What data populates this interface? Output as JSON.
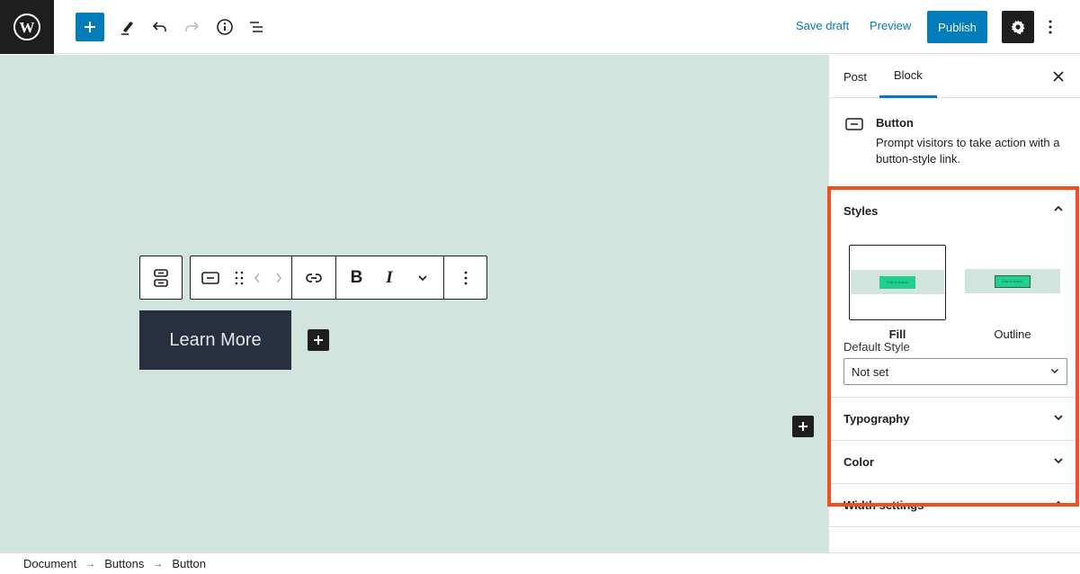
{
  "topbar": {
    "logo": "wordpress-logo",
    "tools": [
      {
        "name": "add-block-toggle",
        "icon": "plus-icon"
      },
      {
        "name": "tools-toggle",
        "icon": "pencil-icon"
      },
      {
        "name": "undo",
        "icon": "undo-icon"
      },
      {
        "name": "redo",
        "icon": "redo-icon",
        "disabled": true
      },
      {
        "name": "details",
        "icon": "info-icon"
      },
      {
        "name": "list-view",
        "icon": "list-view-icon"
      }
    ],
    "save_draft": "Save draft",
    "preview": "Preview",
    "publish": "Publish",
    "settings_icon": "gear-icon",
    "more_icon": "more-vertical-icon"
  },
  "canvas": {
    "background": "#d2e4de",
    "block_toolbar": {
      "groups": [
        [
          "parent-buttons-block-icon"
        ],
        [
          "button-block-icon",
          "drag-handle-icon",
          "move-left-icon",
          "move-right-icon"
        ],
        [
          "link-icon"
        ],
        [
          "bold-icon",
          "italic-icon",
          "more-rich-text-chevron-icon"
        ],
        [
          "options-more-icon"
        ]
      ]
    },
    "button_text": "Learn More",
    "button_color": "#282f3e"
  },
  "sidebar": {
    "tabs": [
      {
        "label": "Post",
        "active": false
      },
      {
        "label": "Block",
        "active": true
      }
    ],
    "close_icon": "close-icon",
    "block": {
      "icon": "button-block-icon",
      "title": "Button",
      "description": "Prompt visitors to take action with a button-style link."
    },
    "highlight_color": "#f04e23",
    "styles": {
      "title": "Styles",
      "expanded": true,
      "options": [
        {
          "label": "Fill",
          "selected": true,
          "preview_text": "Call to Action"
        },
        {
          "label": "Outline",
          "selected": false,
          "preview_text": "Call to Action"
        }
      ],
      "default_style_label": "Default Style",
      "default_style_value": "Not set"
    },
    "panels": [
      {
        "title": "Typography",
        "expanded": false
      },
      {
        "title": "Color",
        "expanded": false
      },
      {
        "title": "Width settings",
        "expanded": true
      }
    ]
  },
  "breadcrumb": [
    "Document",
    "Buttons",
    "Button"
  ],
  "breadcrumb_separator": "→"
}
